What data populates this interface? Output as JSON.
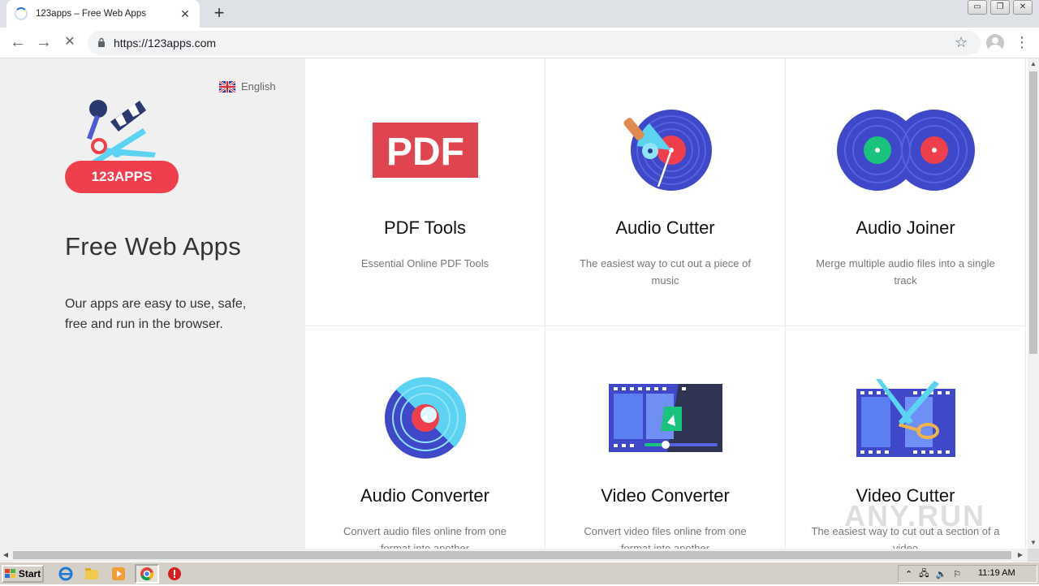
{
  "browser": {
    "tab_title": "123apps – Free Web Apps",
    "tab_close": "✕",
    "new_tab": "+",
    "url": "https://123apps.com",
    "back": "←",
    "forward": "→",
    "stop": "✕",
    "star": "☆",
    "menu": "⋮",
    "window_controls": {
      "minimize": "▭",
      "restore": "❐",
      "close": "✕"
    }
  },
  "sidebar": {
    "language": "English",
    "logo_text": "123APPS",
    "title": "Free Web Apps",
    "description": "Our apps are easy to use, safe, free and run in the browser."
  },
  "apps": [
    {
      "title": "PDF Tools",
      "description": "Essential Online PDF Tools",
      "icon": "pdf-icon",
      "icon_text": "PDF"
    },
    {
      "title": "Audio Cutter",
      "description": "The easiest way to cut out a piece of music",
      "icon": "audio-cutter-icon"
    },
    {
      "title": "Audio Joiner",
      "description": "Merge multiple audio files into a single track",
      "icon": "audio-joiner-icon"
    },
    {
      "title": "Audio Converter",
      "description": "Convert audio files online from one format into another",
      "icon": "audio-converter-icon"
    },
    {
      "title": "Video Converter",
      "description": "Convert video files online from one format into another",
      "icon": "video-converter-icon"
    },
    {
      "title": "Video Cutter",
      "description": "The easiest way to cut out a section of a video",
      "icon": "video-cutter-icon"
    }
  ],
  "taskbar": {
    "start_label": "Start",
    "clock": "11:19 AM"
  },
  "watermark": "ANY.RUN",
  "colors": {
    "pdf_red": "#e0454f",
    "disc_blue": "#3f48c9",
    "disc_red": "#ef3f4c",
    "accent_cyan": "#4fd0f0",
    "accent_green": "#19c37d",
    "sidebar_bg": "#f0f0f0"
  }
}
